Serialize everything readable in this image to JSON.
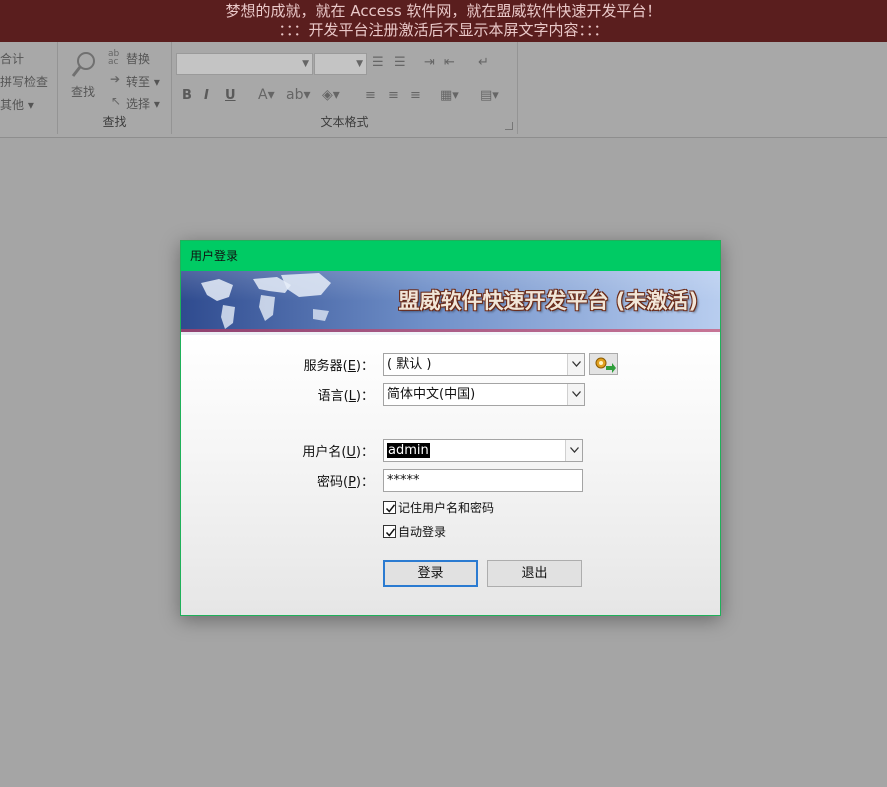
{
  "banner": {
    "line1": "梦想的成就，就在 Access 软件网，就在盟威软件快速开发平台！",
    "line2": "：：：开发平台注册激活后不显示本屏文字内容：：："
  },
  "ribbon": {
    "left_items": [
      "合计",
      "拼写检查",
      "其他 ▾"
    ],
    "find_group": {
      "find_label": "查找",
      "replace_label": "替换",
      "goto_label": "转至 ▾",
      "select_label": "选择 ▾",
      "group_label": "查找"
    },
    "text_format_group": {
      "group_label": "文本格式",
      "bold": "B",
      "italic": "I",
      "underline": "U"
    }
  },
  "dialog": {
    "title": "用户登录",
    "header_title": "盟威软件快速开发平台 (未激活)",
    "server": {
      "label_prefix": "服务器(",
      "label_key": "E",
      "label_suffix": ")：",
      "value": "( 默认 )"
    },
    "language": {
      "label_prefix": "语言(",
      "label_key": "L",
      "label_suffix": ")：",
      "value": "简体中文(中国)"
    },
    "username": {
      "label_prefix": "用户名(",
      "label_key": "U",
      "label_suffix": ")：",
      "value": "admin"
    },
    "password": {
      "label_prefix": "密码(",
      "label_key": "P",
      "label_suffix": ")：",
      "value": "*****"
    },
    "remember": {
      "label": "记住用户名和密码",
      "checked": true
    },
    "autologin": {
      "label": "自动登录",
      "checked": true
    },
    "login_button": "登录",
    "exit_button": "退出"
  },
  "colors": {
    "banner_bg": "#5a1e1e",
    "titlebar_bg": "#00cb64",
    "primary_border": "#2b7bd1"
  }
}
